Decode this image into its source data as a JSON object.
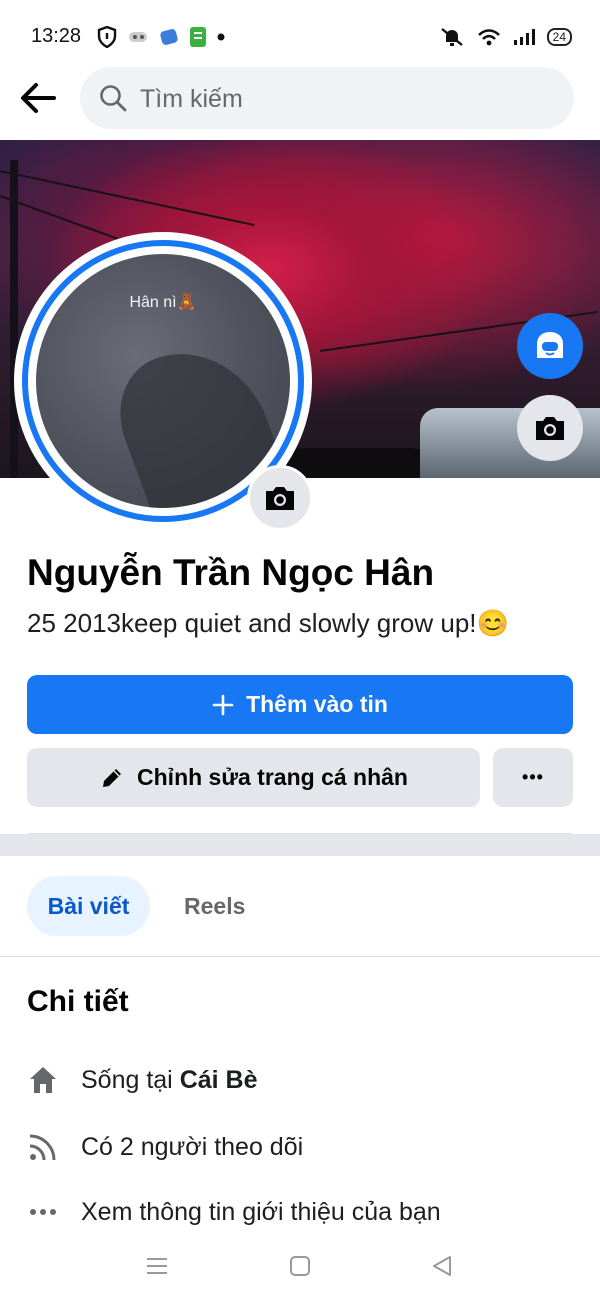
{
  "status": {
    "time": "13:28",
    "battery": "24"
  },
  "search": {
    "placeholder": "Tìm kiếm"
  },
  "cover": {
    "caption": "Hân nì🧸"
  },
  "profile": {
    "name": "Nguyễn Trần Ngọc Hân",
    "bio": "25 2013keep quiet and slowly grow up!😊"
  },
  "actions": {
    "add_story": "Thêm vào tin",
    "edit_profile": "Chỉnh sửa trang cá nhân",
    "more": "•••"
  },
  "tabs": [
    {
      "label": "Bài viết"
    },
    {
      "label": "Reels"
    }
  ],
  "details": {
    "title": "Chi tiết",
    "lives_prefix": "Sống tại ",
    "lives_place": "Cái Bè",
    "followers": "Có 2 người theo dõi",
    "intro": "Xem thông tin giới thiệu của bạn"
  },
  "colors": {
    "accent": "#1877f2",
    "button_gray": "#e4e6eb",
    "tab_active_bg": "#e7f3ff"
  }
}
